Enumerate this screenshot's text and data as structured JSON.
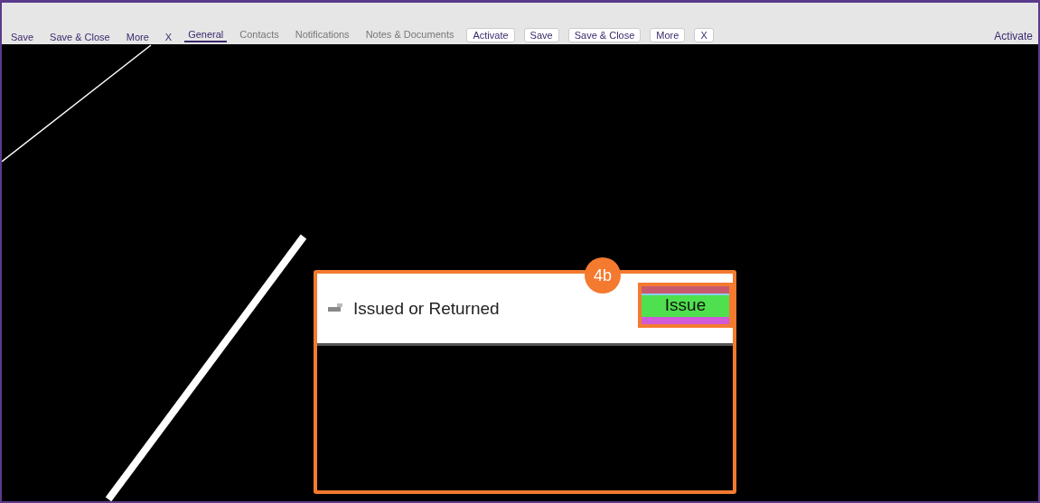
{
  "toolbar": {
    "buttons": [
      {
        "label": "Save"
      },
      {
        "label": "Save & Close"
      },
      {
        "label": "More"
      },
      {
        "label": "X"
      }
    ]
  },
  "tabs": [
    {
      "label": "General",
      "selected": true
    },
    {
      "label": "Contacts",
      "selected": false
    },
    {
      "label": "Notifications",
      "selected": false
    },
    {
      "label": "Notes & Documents",
      "selected": false
    }
  ],
  "overlay_buttons": [
    "Activate",
    "Save",
    "Save & Close",
    "More",
    "X"
  ],
  "activate_link": "Activate",
  "callout": {
    "badge": "4b",
    "title": "Issued or Returned",
    "button": "Issue"
  }
}
